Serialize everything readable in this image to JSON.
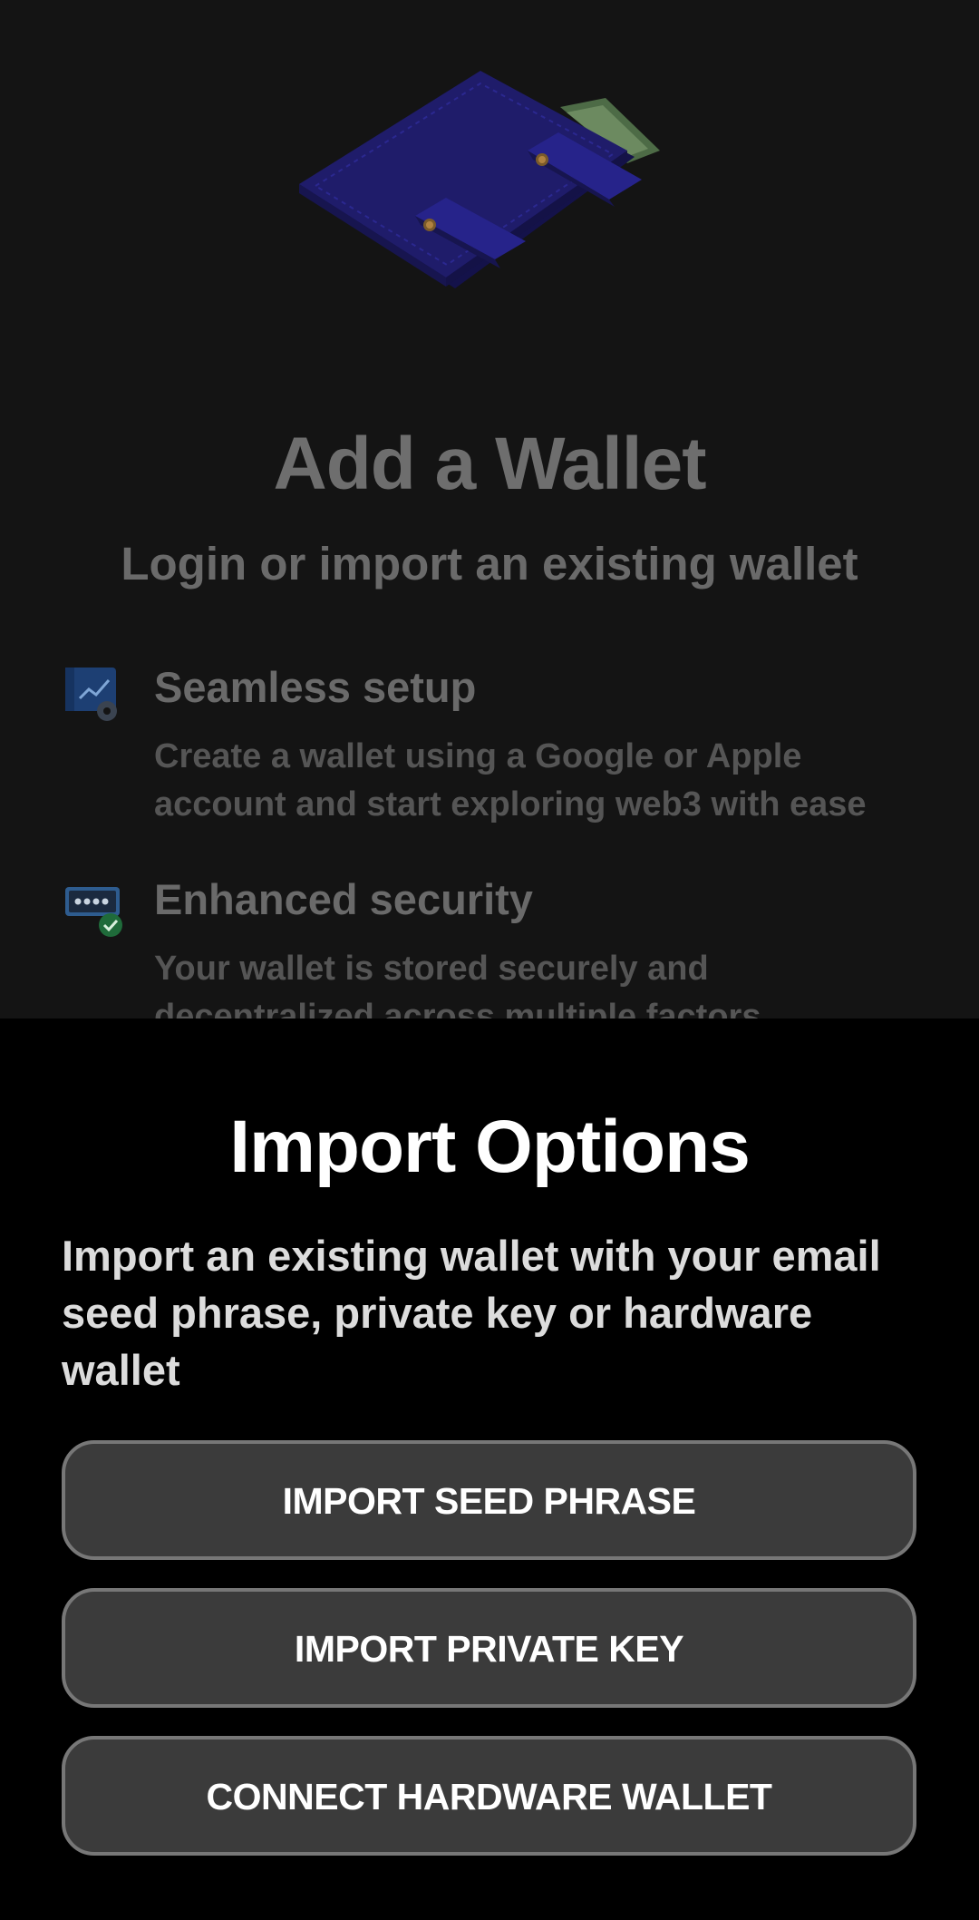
{
  "background_page": {
    "title": "Add a Wallet",
    "subtitle": "Login or import an existing wallet",
    "features": [
      {
        "icon": "browser-chart-gear-icon",
        "title": "Seamless setup",
        "description": "Create a wallet using a Google or Apple account and start exploring web3 with ease"
      },
      {
        "icon": "password-shield-check-icon",
        "title": "Enhanced security",
        "description": "Your wallet is stored securely and decentralized across multiple factors"
      }
    ]
  },
  "import_sheet": {
    "title": "Import Options",
    "description": "Import an existing wallet with your email seed phrase, private key or hardware wallet",
    "buttons": {
      "seed_phrase": "IMPORT SEED PHRASE",
      "private_key": "IMPORT PRIVATE KEY",
      "hardware_wallet": "CONNECT HARDWARE WALLET"
    }
  },
  "colors": {
    "sheet_background": "#000000",
    "button_background": "#3b3b3b",
    "button_border": "#777777",
    "wallet_illustration": "#1d1b66"
  }
}
